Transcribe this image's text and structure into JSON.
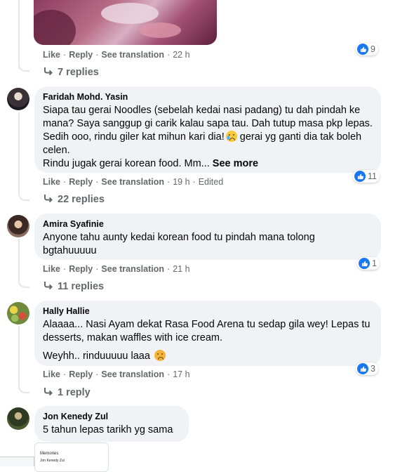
{
  "photo_comment": {
    "actions": {
      "like": "Like",
      "reply": "Reply",
      "translate": "See translation",
      "time": "22 h"
    },
    "reactions": "9",
    "replies": "7 replies"
  },
  "comments": [
    {
      "author": "Faridah Mohd. Yasin",
      "text": "Siapa tau gerai Noodles (sebelah kedai nasi padang) tu dah pindah ke mana? Saya sanggup gi carik kalau sapa tau. Dah tutup masa pkp lepas. Sedih ooo, rindu giler kat mihun kari dia!",
      "text_tail": " gerai yg ganti dia tak boleh celen.",
      "text_line2": "Rindu jugak gerai korean food. Mm...",
      "see_more": "See more",
      "emoji": "crying-face",
      "actions": {
        "like": "Like",
        "reply": "Reply",
        "translate": "See translation",
        "time": "19 h",
        "edited": "Edited"
      },
      "reactions": "11",
      "replies": "22 replies"
    },
    {
      "author": "Amira Syafinie",
      "text": "Anyone tahu aunty kedai korean food tu pindah mana tolong bgtahuuuuu",
      "actions": {
        "like": "Like",
        "reply": "Reply",
        "translate": "See translation",
        "time": "21 h"
      },
      "reactions": "1",
      "replies": "11 replies"
    },
    {
      "author": "Hally Hallie",
      "text": "Alaaaa... Nasi Ayam dekat Rasa Food Arena tu sedap gila wey! Lepas tu desserts, makan waffles with ice cream.",
      "text_p2": "Weyhh.. rinduuuuu laaa",
      "emoji": "disappointed-face",
      "actions": {
        "like": "Like",
        "reply": "Reply",
        "translate": "See translation",
        "time": "17 h"
      },
      "reactions": "3",
      "replies": "1 reply"
    },
    {
      "author": "Jon Kenedy Zul",
      "text": "5 tahun lepas tarikh yg sama",
      "attachment": {
        "title": "Memories",
        "row": "Jon Kenedy Zul"
      }
    }
  ],
  "colors": {
    "bubble": "#f0f2f5",
    "meta": "#65676b",
    "like_blue": "#1877f2",
    "thread": "#e4e6eb"
  }
}
